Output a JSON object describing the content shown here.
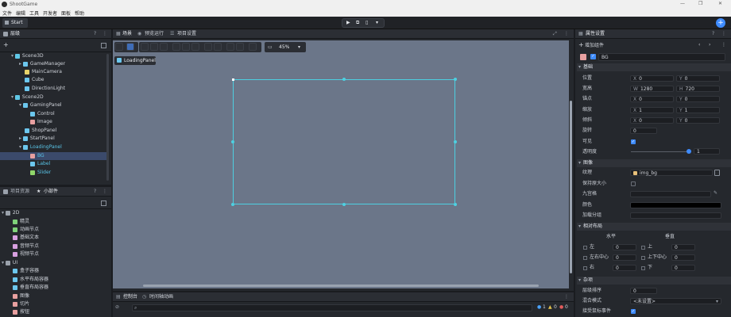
{
  "window": {
    "title": "ShootGame"
  },
  "menu": [
    "文件",
    "编辑",
    "工具",
    "开发者",
    "面板",
    "帮助"
  ],
  "doc_tab": "Start",
  "hierarchy": {
    "tab": "层级",
    "items": [
      "Scene3D",
      "GameManager",
      "MainCamera",
      "Cube",
      "DirectionLight",
      "Scene2D",
      "GamingPanel",
      "Control",
      "Image",
      "ShopPanel",
      "StartPanel",
      "LoadingPanel",
      "BG",
      "Label",
      "Slider"
    ]
  },
  "widgets": {
    "tabs": [
      "项目资源",
      "小部件"
    ],
    "groups": [
      {
        "name": "2D",
        "items": [
          "精灵",
          "动画节点",
          "基础文本",
          "音频节点",
          "视频节点"
        ]
      },
      {
        "name": "UI",
        "items": [
          "盒子容器",
          "水平布局容器",
          "垂直布局容器",
          "图像",
          "切片",
          "按钮"
        ]
      }
    ]
  },
  "scene": {
    "tabs": [
      "场景",
      "预览运行",
      "项目设置"
    ],
    "zoom": "45%",
    "breadcrumb": "LoadingPanel"
  },
  "console": {
    "tabs": [
      "控制台",
      "时间轴动画"
    ],
    "counts": [
      "1",
      "0",
      "0"
    ]
  },
  "inspector": {
    "tab": "属性设置",
    "add_component": "增加组件",
    "node_name": "BG",
    "sections": {
      "basic": "基础",
      "image": "图像",
      "layout": "相对布局",
      "misc": "杂项"
    },
    "position": {
      "label": "位置",
      "x": "0",
      "y": "0"
    },
    "size": {
      "label": "宽高",
      "x": "1280",
      "y": "720"
    },
    "anchor": {
      "label": "锚点",
      "x": "0",
      "y": "0"
    },
    "scale": {
      "label": "缩放",
      "x": "1",
      "y": "1"
    },
    "skew": {
      "label": "倾斜",
      "x": "0",
      "y": "0"
    },
    "rotation": {
      "label": "旋转",
      "value": "0"
    },
    "visible": {
      "label": "可见"
    },
    "alpha": {
      "label": "透明度",
      "value": "1"
    },
    "texture": {
      "label": "纹理",
      "value": "img_bg"
    },
    "keep_size": {
      "label": "保持原大小"
    },
    "nine_grid": {
      "label": "九宫格"
    },
    "color": {
      "label": "颜色",
      "hex": "#000000"
    },
    "tile": {
      "label": "加载分组"
    },
    "layout": {
      "horizontal": "水平",
      "vertical": "垂直",
      "left": "左",
      "center_h": "左右中心",
      "right": "右",
      "top": "上",
      "center_v": "上下中心",
      "bottom": "下",
      "zero": "0"
    },
    "misc": {
      "z_order": {
        "label": "层级排序",
        "value": "0"
      },
      "blend": {
        "label": "混合模式",
        "value": "<未设置>"
      },
      "mouse": {
        "label": "接受鼠标事件"
      }
    }
  },
  "colors": {
    "accent": "#4dd0e1",
    "canvas": "#6b7689",
    "selection": "#3b4a6b",
    "blue": "#3f8cff"
  }
}
